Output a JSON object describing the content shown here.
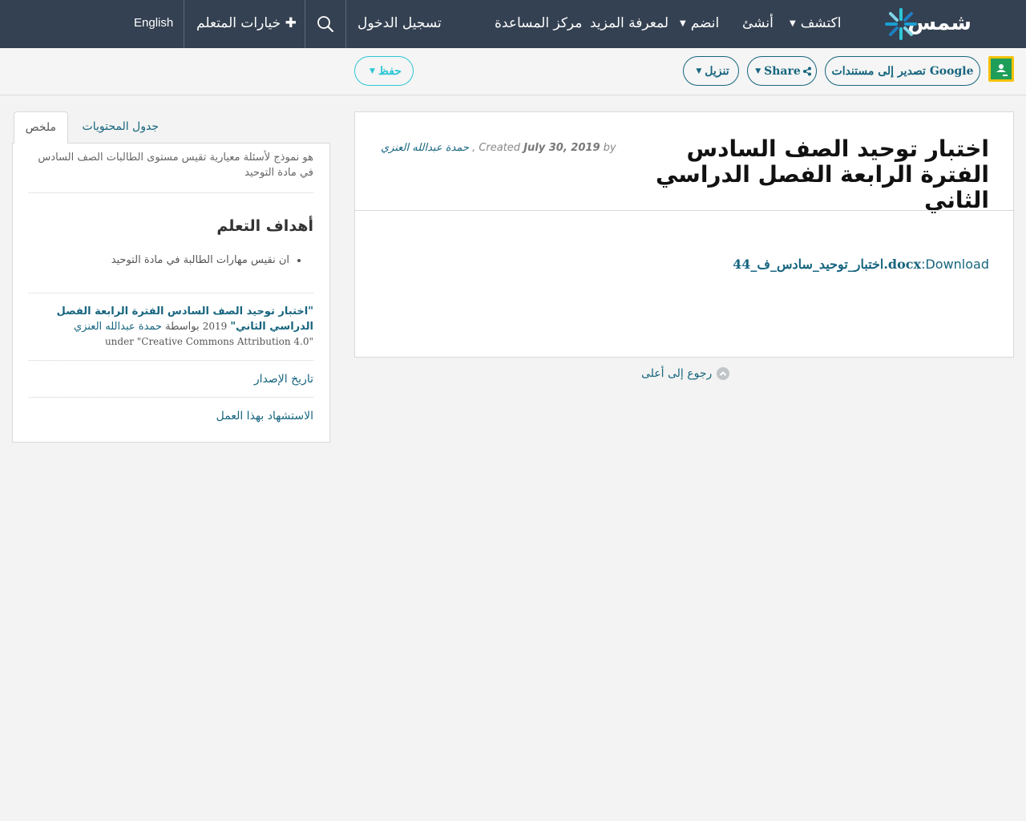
{
  "nav": {
    "logo_text": "شمس",
    "discover": "اكتشف",
    "create": "أنشئ",
    "join": "انضم",
    "learn_more": "لمعرفة المزيد",
    "help_center": "مركز المساعدة",
    "sign_in": "تسجيل الدخول",
    "learner_options": "خيارات المتعلم",
    "language": "English"
  },
  "toolbar": {
    "export_google": "تصدير إلى مستندات Google",
    "share": "Share",
    "download": "تنزيل",
    "save": "حفظ"
  },
  "resource": {
    "title": "اختبار توحيد الصف السادس الفترة الرابعة الفصل الدراسي الثاني",
    "by_label": "by",
    "author": "حمدة عبدالله العنزي",
    "created_label": "Created",
    "date": "July 30, 2019",
    "download_label": "Download",
    "file_name": "اختبار_توحيد_سادس_ف_44.docx"
  },
  "back_to_top": "رجوع إلى أعلى",
  "sidebar": {
    "tab_summary": "ملخص",
    "tab_contents": "جدول المحتويات",
    "summary_text": "هو نموذج لأسئلة معيارية تقيس مستوى الطالبات الصف السادس في مادة التوحيد",
    "objectives_heading": "أهداف التعلم",
    "objectives": [
      "ان نقيس مهارات الطالبة في مادة التوحيد"
    ],
    "citation_title": "\"اختبار توحيد الصف السادس الفترة الرابعة الفصل الدراسي الثاني\"",
    "citation_year": "2019",
    "citation_by": "بواسطة",
    "citation_author": "حمدة عبدالله العنزي",
    "citation_license": "under \"Creative Commons Attribution 4.0\"",
    "version_history": "تاريخ الإصدار",
    "cite_work": "الاستشهاد بهذا العمل"
  },
  "colors": {
    "nav_bg": "#344152",
    "link": "#17657f",
    "save_accent": "#2dc6d6"
  }
}
